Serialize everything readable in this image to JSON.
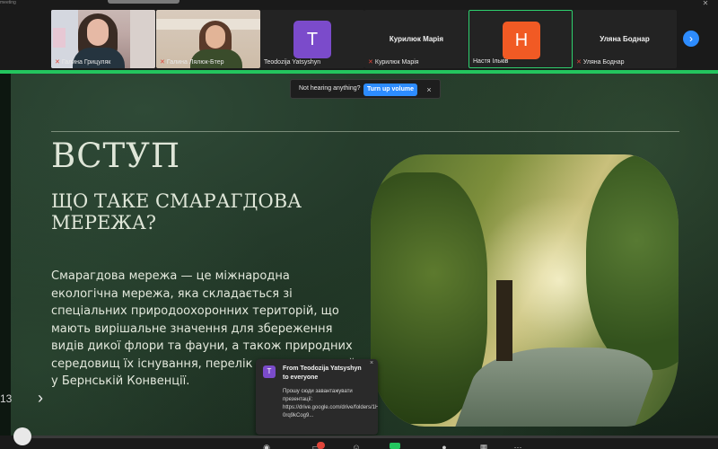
{
  "window": {
    "top_left_fragment": "meeting",
    "close_glyph": "✕"
  },
  "participants": [
    {
      "name": "Галина Грицуляк",
      "muted": true,
      "type": "video"
    },
    {
      "name": "Галина Лялюк-Бтер",
      "muted": true,
      "type": "video"
    },
    {
      "name": "Teodozija Yatsyshyn",
      "muted": false,
      "type": "avatar",
      "initial": "T",
      "color": "#7b4bcb"
    },
    {
      "name": "Курилюк Марія",
      "display_name": "Курилюк Марія",
      "muted": true,
      "type": "name-only"
    },
    {
      "name": "Настя Ільків",
      "muted": false,
      "type": "avatar",
      "initial": "Н",
      "color": "#f15a24",
      "active_speaker": true
    },
    {
      "name": "Уляна Боднар",
      "display_name": "Уляна Боднар",
      "muted": true,
      "type": "name-only"
    }
  ],
  "gallery_next_icon": "chevron-right-icon",
  "audio_banner": {
    "text": "Not hearing anything?",
    "button": "Turn up volume",
    "close": "×"
  },
  "slide": {
    "title": "ВСТУП",
    "subtitle": "ЩО ТАКЕ СМАРАГДОВА МЕРЕЖА?",
    "body": "Смарагдова мережа — це міжнародна екологічна мережа, яка складається зі спеціальних природоохоронних територій, що мають вирішальне значення для збереження видів дикої флори та фауни, а також природних середовищ їх існування, перелік яких наведений у Бернській Конвенції.",
    "page_number": "13",
    "next_glyph": "›"
  },
  "chat_popup": {
    "avatar_initial": "T",
    "from": "From Teodozija Yatsyshyn to everyone",
    "message": "Прошу сюди завантажувати презентації: https://drive.google.com/drive/folders/1HN6dh_FRk-0rq9kCog9...",
    "close": "×"
  },
  "colors": {
    "accent_blue": "#2d8cff",
    "active_green": "#23c55e",
    "mute_red": "#e0453a"
  }
}
